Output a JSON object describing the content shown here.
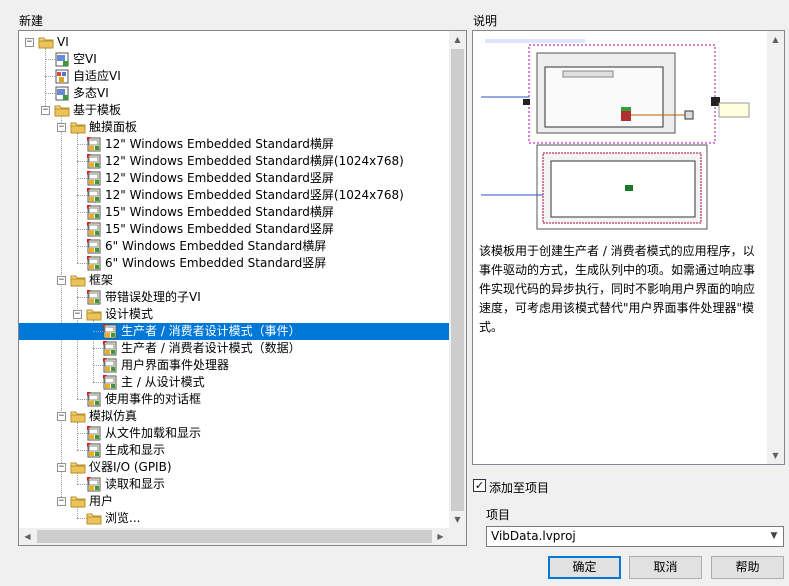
{
  "labels": {
    "new": "新建",
    "description": "说明",
    "project": "项目"
  },
  "tree": [
    {
      "label": "VI",
      "level": 0,
      "kind": "folder",
      "expanded": true
    },
    {
      "label": "空VI",
      "level": 1,
      "kind": "vi"
    },
    {
      "label": "自适应VI",
      "level": 1,
      "kind": "vi-poly"
    },
    {
      "label": "多态VI",
      "level": 1,
      "kind": "vi"
    },
    {
      "label": "基于模板",
      "level": 1,
      "kind": "folder",
      "expanded": true
    },
    {
      "label": "触摸面板",
      "level": 2,
      "kind": "folder",
      "expanded": true
    },
    {
      "label": "12\" Windows Embedded Standard横屏",
      "level": 3,
      "kind": "template"
    },
    {
      "label": "12\" Windows Embedded Standard横屏(1024x768)",
      "level": 3,
      "kind": "template"
    },
    {
      "label": "12\" Windows Embedded Standard竖屏",
      "level": 3,
      "kind": "template"
    },
    {
      "label": "12\" Windows Embedded Standard竖屏(1024x768)",
      "level": 3,
      "kind": "template"
    },
    {
      "label": "15\" Windows Embedded Standard横屏",
      "level": 3,
      "kind": "template"
    },
    {
      "label": "15\" Windows Embedded Standard竖屏",
      "level": 3,
      "kind": "template"
    },
    {
      "label": "6\" Windows Embedded Standard横屏",
      "level": 3,
      "kind": "template"
    },
    {
      "label": "6\" Windows Embedded Standard竖屏",
      "level": 3,
      "kind": "template"
    },
    {
      "label": "框架",
      "level": 2,
      "kind": "folder",
      "expanded": true
    },
    {
      "label": "带错误处理的子VI",
      "level": 3,
      "kind": "template"
    },
    {
      "label": "设计模式",
      "level": 3,
      "kind": "folder",
      "expanded": true
    },
    {
      "label": "生产者 / 消费者设计模式（事件）",
      "level": 4,
      "kind": "template",
      "selected": true
    },
    {
      "label": "生产者 / 消费者设计模式（数据）",
      "level": 4,
      "kind": "template"
    },
    {
      "label": "用户界面事件处理器",
      "level": 4,
      "kind": "template"
    },
    {
      "label": "主 / 从设计模式",
      "level": 4,
      "kind": "template"
    },
    {
      "label": "使用事件的对话框",
      "level": 3,
      "kind": "template"
    },
    {
      "label": "模拟仿真",
      "level": 2,
      "kind": "folder",
      "expanded": true
    },
    {
      "label": "从文件加载和显示",
      "level": 3,
      "kind": "template"
    },
    {
      "label": "生成和显示",
      "level": 3,
      "kind": "template"
    },
    {
      "label": "仪器I/O (GPIB)",
      "level": 2,
      "kind": "folder",
      "expanded": true
    },
    {
      "label": "读取和显示",
      "level": 3,
      "kind": "template"
    },
    {
      "label": "用户",
      "level": 2,
      "kind": "folder",
      "expanded": true
    },
    {
      "label": "浏览...",
      "level": 3,
      "kind": "folder-plain"
    }
  ],
  "description": {
    "text": "该模板用于创建生产者 / 消费者模式的应用程序，以事件驱动的方式，生成队列中的项。如需通过响应事件实现代码的异步执行，同时不影响用户界面的响应速度，可考虑用该模式替代\"用户界面事件处理器\"模式。"
  },
  "add_to_project": {
    "label": "添加至项目",
    "checked": true
  },
  "project_select": {
    "value": "VibData.lvproj"
  },
  "buttons": {
    "ok": "确定",
    "cancel": "取消",
    "help": "帮助"
  },
  "colors": {
    "selection": "#0078d7",
    "folder": "#e8c25a",
    "window_bg": "#f0f0f0"
  }
}
